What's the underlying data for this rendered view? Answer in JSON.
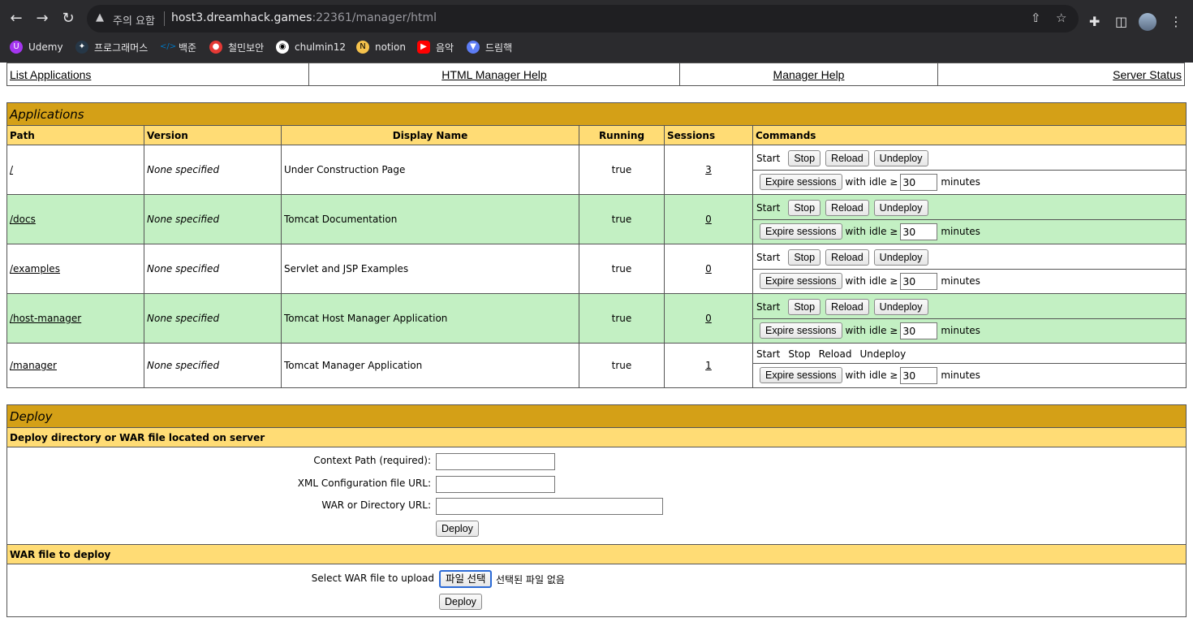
{
  "browser": {
    "warning": "주의 요함",
    "url_host": "host3.dreamhack.games",
    "url_path": ":22361/manager/html",
    "bookmarks": [
      {
        "label": "Udemy",
        "icon": "udemy-icon",
        "color": "#a435f0"
      },
      {
        "label": "프로그래머스",
        "icon": "programmers-icon",
        "color": "#263747"
      },
      {
        "label": "백준",
        "icon": "baekjoon-icon",
        "color": "#0076c0"
      },
      {
        "label": "철민보안",
        "icon": "chulmin-security-icon",
        "color": "#e53935"
      },
      {
        "label": "chulmin12",
        "icon": "github-icon",
        "color": "#ffffff"
      },
      {
        "label": "notion",
        "icon": "notion-icon",
        "color": "#f5c24c"
      },
      {
        "label": "음악",
        "icon": "youtube-icon",
        "color": "#ff0000"
      },
      {
        "label": "드림핵",
        "icon": "dreamhack-icon",
        "color": "#5d7df5"
      }
    ]
  },
  "nav": {
    "list_applications": "List Applications",
    "html_manager_help": "HTML Manager Help",
    "manager_help": "Manager Help",
    "server_status": "Server Status"
  },
  "applications": {
    "title": "Applications",
    "columns": {
      "path": "Path",
      "version": "Version",
      "display_name": "Display Name",
      "running": "Running",
      "sessions": "Sessions",
      "commands": "Commands"
    },
    "rows": [
      {
        "path": "/",
        "version": "None specified",
        "display_name": "Under Construction Page",
        "running": "true",
        "sessions": "3"
      },
      {
        "path": "/docs",
        "version": "None specified",
        "display_name": "Tomcat Documentation",
        "running": "true",
        "sessions": "0"
      },
      {
        "path": "/examples",
        "version": "None specified",
        "display_name": "Servlet and JSP Examples",
        "running": "true",
        "sessions": "0"
      },
      {
        "path": "/host-manager",
        "version": "None specified",
        "display_name": "Tomcat Host Manager Application",
        "running": "true",
        "sessions": "0"
      },
      {
        "path": "/manager",
        "version": "None specified",
        "display_name": "Tomcat Manager Application",
        "running": "true",
        "sessions": "1"
      }
    ],
    "cmd": {
      "start": "Start",
      "stop": "Stop",
      "reload": "Reload",
      "undeploy": "Undeploy",
      "expire": "Expire sessions",
      "with_idle": "with idle ≥",
      "idle_value": "30",
      "minutes": "minutes"
    }
  },
  "deploy": {
    "title": "Deploy",
    "section1": "Deploy directory or WAR file located on server",
    "context_path_label": "Context Path (required):",
    "xml_config_label": "XML Configuration file URL:",
    "war_dir_label": "WAR or Directory URL:",
    "deploy_button": "Deploy",
    "section2": "WAR file to deploy",
    "select_war_label": "Select WAR file to upload",
    "choose_file_button": "파일 선택",
    "no_file": "선택된 파일 없음",
    "deploy_button2": "Deploy"
  }
}
